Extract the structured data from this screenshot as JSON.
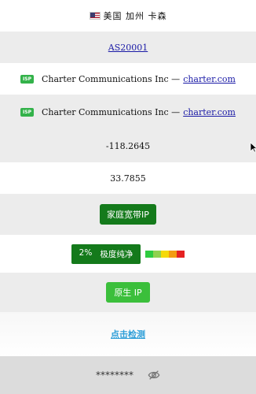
{
  "location": {
    "flag": "us-flag-icon",
    "text": "美国 加州 卡森"
  },
  "asn": {
    "label": "AS20001"
  },
  "isp_rows": [
    {
      "badge": "ISP",
      "name": "Charter Communications Inc —",
      "domain": "charter.com"
    },
    {
      "badge": "ISP",
      "name": "Charter Communications Inc —",
      "domain": "charter.com"
    }
  ],
  "longitude": "-118.2645",
  "latitude": "33.7855",
  "ip_type": {
    "label": "家庭宽带IP"
  },
  "purity": {
    "percent": "2%",
    "label": "极度纯净",
    "scale_colors": [
      "#2ecc40",
      "#8fd14f",
      "#f5d90a",
      "#f39c12",
      "#e52222"
    ]
  },
  "native_ip": {
    "label": "原生 IP"
  },
  "detect": {
    "label": "点击检测"
  },
  "password": {
    "masked": "********",
    "toggle_icon": "eye-slash-icon"
  },
  "colors": {
    "grey_row": "#ececec",
    "dark_green": "#147a1b",
    "light_green": "#3bbf3b",
    "link_blue": "#2f9fd8"
  }
}
